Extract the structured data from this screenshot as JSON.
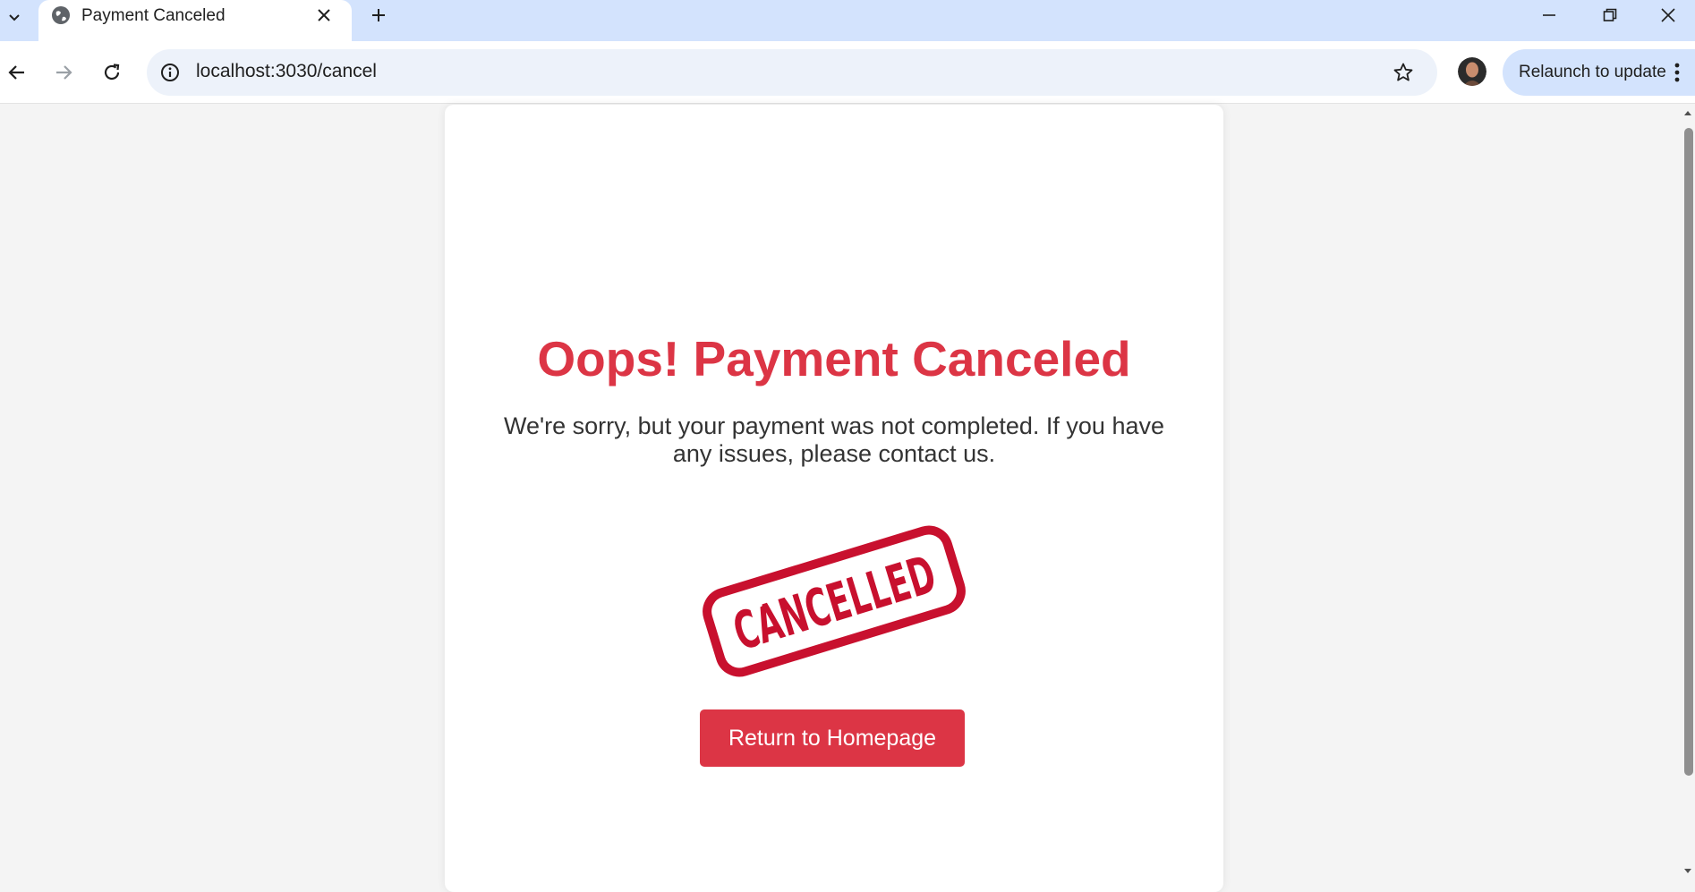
{
  "browser": {
    "tab": {
      "title": "Payment Canceled"
    },
    "url": "localhost:3030/cancel",
    "relaunch_label": "Relaunch to update"
  },
  "page": {
    "heading": "Oops! Payment Canceled",
    "message": "We're sorry, but your payment was not completed. If you have any issues, please contact us.",
    "stamp_text": "CANCELLED",
    "button_label": "Return to Homepage"
  },
  "colors": {
    "accent": "#dc3545",
    "tabstrip": "#d3e3fd",
    "omnibox": "#edf2fa"
  }
}
